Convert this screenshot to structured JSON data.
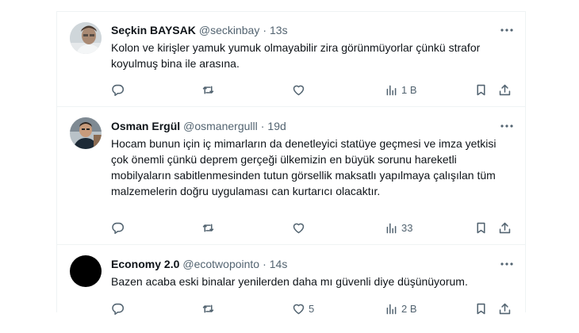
{
  "tweets": [
    {
      "display_name": "Seçkin BAYSAK",
      "handle": "@seckinbay",
      "separator": "·",
      "time": "13s",
      "text": "Kolon ve kirişler yamuk yumuk olmayabilir zira görünmüyorlar çünkü strafor koyulmuş bina ile arasına.",
      "reply_count": "",
      "retweet_count": "",
      "like_count": "",
      "view_count": "1 B",
      "avatar": "profile-photo"
    },
    {
      "display_name": "Osman Ergül",
      "handle": "@osmanergulll",
      "separator": "·",
      "time": "19d",
      "text": "Hocam bunun için iç mimarların da denetleyici statüye geçmesi ve imza yetkisi çok önemli çünkü deprem gerçeği ülkemizin en büyük sorunu hareketli mobilyaların sabitlenmesinden tutun görsellik maksatlı yapılmaya çalışılan tüm malzemelerin doğru uygulaması can kurtarıcı olacaktır.",
      "reply_count": "",
      "retweet_count": "",
      "like_count": "",
      "view_count": "33",
      "avatar": "profile-photo"
    },
    {
      "display_name": "Economy 2.0",
      "handle": "@ecotwopointo",
      "separator": "·",
      "time": "14s",
      "text": "Bazen acaba eski binalar yenilerden daha mı güvenli diye düşünüyorum.",
      "reply_count": "",
      "retweet_count": "",
      "like_count": "5",
      "view_count": "2 B",
      "avatar": "black-circle"
    }
  ],
  "colors": {
    "text_primary": "#0f1419",
    "text_secondary": "#536471",
    "divider": "#eff3f4"
  },
  "icons": [
    "more-icon",
    "reply-icon",
    "retweet-icon",
    "like-icon",
    "views-icon",
    "bookmark-icon",
    "share-icon"
  ]
}
